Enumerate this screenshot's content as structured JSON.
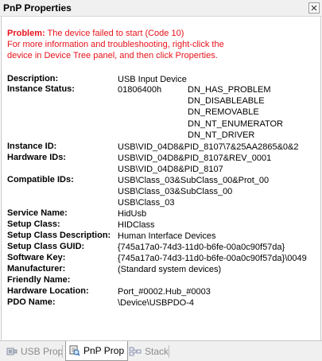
{
  "window": {
    "title": "PnP Properties",
    "close_glyph": "x"
  },
  "problem": {
    "label": "Problem:",
    "message": "The device failed to start (Code 10)",
    "line2": "For more information and troubleshooting, right-click the",
    "line3": "device in Device Tree panel, and then click Properties."
  },
  "properties": {
    "description": {
      "label": "Description:",
      "value": "USB Input Device"
    },
    "instance_status": {
      "label": "Instance Status:",
      "value": "01806400h",
      "flags": [
        "DN_HAS_PROBLEM",
        "DN_DISABLEABLE",
        "DN_REMOVABLE",
        "DN_NT_ENUMERATOR",
        "DN_NT_DRIVER"
      ]
    },
    "instance_id": {
      "label": "Instance ID:",
      "value": "USB\\VID_04D8&PID_8107\\7&25AA2865&0&2"
    },
    "hardware_ids": {
      "label": "Hardware IDs:",
      "values": [
        "USB\\VID_04D8&PID_8107&REV_0001",
        "USB\\VID_04D8&PID_8107"
      ]
    },
    "compatible_ids": {
      "label": "Compatible IDs:",
      "values": [
        "USB\\Class_03&SubClass_00&Prot_00",
        "USB\\Class_03&SubClass_00",
        "USB\\Class_03"
      ]
    },
    "service_name": {
      "label": "Service Name:",
      "value": "HidUsb"
    },
    "setup_class": {
      "label": "Setup Class:",
      "value": "HIDClass"
    },
    "setup_class_description": {
      "label": "Setup Class Description:",
      "value": "Human Interface Devices"
    },
    "setup_class_guid": {
      "label": "Setup Class GUID:",
      "value": "{745a17a0-74d3-11d0-b6fe-00a0c90f57da}"
    },
    "software_key": {
      "label": "Software Key:",
      "value": "{745a17a0-74d3-11d0-b6fe-00a0c90f57da}\\0049"
    },
    "manufacturer": {
      "label": "Manufacturer:",
      "value": "(Standard system devices)"
    },
    "friendly_name": {
      "label": "Friendly Name:",
      "value": ""
    },
    "hardware_location": {
      "label": "Hardware Location:",
      "value": "Port_#0002.Hub_#0003"
    },
    "pdo_name": {
      "label": "PDO Name:",
      "value": "\\Device\\USBPDO-4"
    }
  },
  "tabs": [
    {
      "label": "USB Prop",
      "icon": "usb-icon",
      "active": false
    },
    {
      "label": "PnP Prop",
      "icon": "magnifier-icon",
      "active": true
    },
    {
      "label": "Stack",
      "icon": "stack-icon",
      "active": false
    }
  ],
  "colors": {
    "problem_text": "#e8121b",
    "tab_inactive_text": "#8a8a8a"
  }
}
